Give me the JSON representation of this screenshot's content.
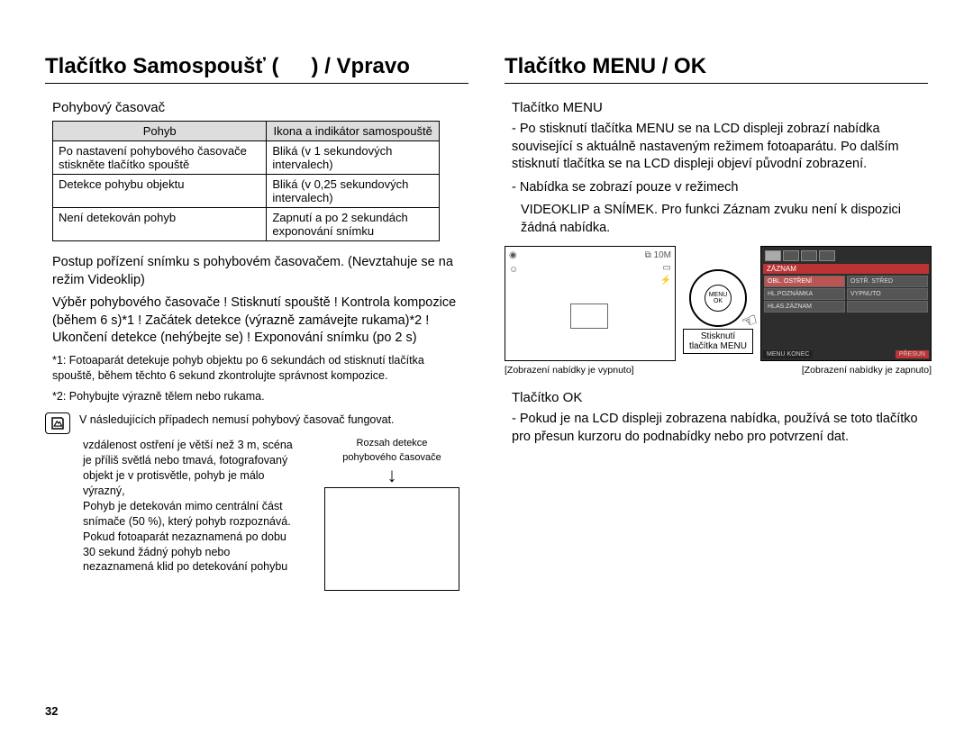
{
  "pagenum": "32",
  "left": {
    "heading_prefix": "Tlačítko Samospoušť (",
    "heading_suffix": ") / Vpravo",
    "motion_timer_label": "Pohybový časovač",
    "table": {
      "h1": "Pohyb",
      "h2": "Ikona a indikátor samospouště",
      "rows": [
        [
          "Po nastavení pohybového časovače stiskněte tlačítko spouště",
          "Bliká (v 1 sekundových intervalech)"
        ],
        [
          "Detekce pohybu objektu",
          "Bliká (v 0,25 sekundových intervalech)"
        ],
        [
          "Není detekován pohyb",
          "Zapnutí a po 2 sekundách exponování snímku"
        ]
      ]
    },
    "para1": "Postup pořízení snímku s pohybovém časovačem. (Nevztahuje se na režim Videoklip)",
    "para2": "Výběr pohybového časovače !   Stisknutí spouště !   Kontrola kompozice (během 6 s)*1 !   Začátek detekce (výrazně zamávejte rukama)*2 !   Ukončení detekce (nehýbejte se) !   Exponování snímku (po 2 s)",
    "fn1": "*1: Fotoaparát detekuje pohyb objektu po 6 sekundách od stisknutí tlačítka spouště, během těchto 6 sekund zkontrolujte správnost kompozice.",
    "fn2": "*2: Pohybujte výrazně tělem nebo rukama.",
    "note_intro": "V následujících případech nemusí pohybový časovač fungovat.",
    "note_items": "vzdálenost ostření je větší než 3 m, scéna je příliš světlá nebo tmavá, fotografovaný objekt je v protisvětle, pohyb je málo výrazný,",
    "note_items2": "Pohyb je detekován mimo centrální část snímače (50 %), který pohyb rozpoznává. Pokud fotoaparát nezaznamená po dobu 30 sekund žádný pohyb nebo nezaznamená klid po detekování pohybu",
    "detect_caption1": "Rozsah detekce",
    "detect_caption2": "pohybového časovače"
  },
  "right": {
    "heading": "Tlačítko MENU / OK",
    "menu_label": "Tlačítko MENU",
    "menu_p1": "- Po stisknutí tlačítka MENU se na LCD displeji zobrazí nabídka související s aktuálně nastaveným režimem fotoaparátu. Po dalším stisknutí tlačítka se na LCD displeji objeví původní zobrazení.",
    "menu_p2": "- Nabídka se zobrazí pouze v režimech",
    "menu_p3": "VIDEOKLIP a SNÍMEK. Pro funkci Záznam zvuku není k dispozici žádná nabídka.",
    "press_label": "Stisknutí tlačítka MENU",
    "cap_off": "[Zobrazení nabídky je vypnuto]",
    "cap_on": "[Zobrazení nabídky je zapnuto]",
    "wheel_menu": "MENU",
    "wheel_ok": "OK",
    "ok_label": "Tlačítko OK",
    "ok_p1": "- Pokud je na LCD displeji zobrazena nabídka, používá se toto tlačítko pro přesun kurzoru do podnabídky nebo pro potvrzení dat.",
    "menucells": {
      "band": "ZÁZNAM",
      "r1a": "OBL. OSTŘENÍ",
      "r1b": "OSTŘ. STŘED",
      "r2a": "HL.POZNÁMKA",
      "r2b": "VYPNUTO",
      "r3a": "HLAS.ZÁZNAM",
      "foot_l": "MENU KONEC",
      "foot_r": "PŘESUN"
    }
  }
}
